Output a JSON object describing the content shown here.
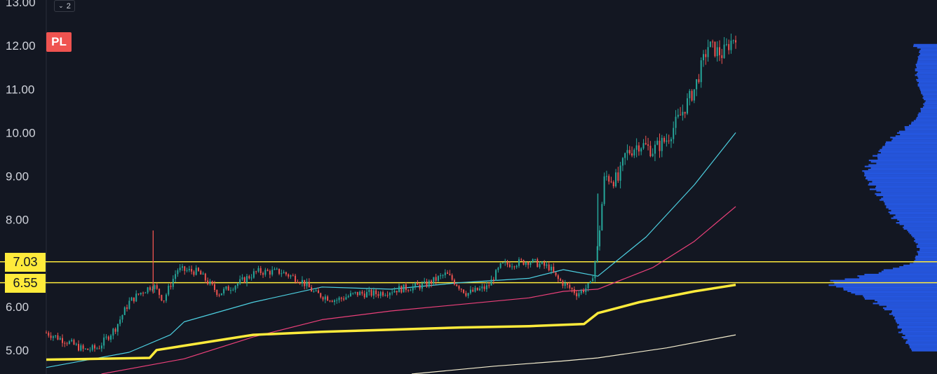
{
  "header": {
    "ticker": "PL",
    "indicator_toggle_count": "2"
  },
  "colors": {
    "background": "#131722",
    "bull": "#26a69a",
    "bear": "#ef5350",
    "ma_cyan": "#4dd0e1",
    "ma_pink": "#ec407a",
    "vwap_yellow": "#ffeb3b",
    "ma_long": "#f5eecf",
    "volume_profile": "#2962ff",
    "level_line": "#ffeb3b"
  },
  "chart_data": {
    "type": "candlestick",
    "y_axis": {
      "ticks": [
        "13.00",
        "12.00",
        "11.00",
        "10.00",
        "9.00",
        "8.00",
        "6.00",
        "5.00"
      ],
      "ylim": [
        4.45,
        13.05
      ]
    },
    "levels": [
      {
        "label": "7.03",
        "value": 7.03
      },
      {
        "label": "6.55",
        "value": 6.55
      }
    ],
    "price_anchors": [
      [
        0,
        5.4
      ],
      [
        0.03,
        5.2
      ],
      [
        0.055,
        5.0
      ],
      [
        0.075,
        5.05
      ],
      [
        0.1,
        5.5
      ],
      [
        0.12,
        6.1
      ],
      [
        0.135,
        6.3
      ],
      [
        0.155,
        6.5
      ],
      [
        0.17,
        6.15
      ],
      [
        0.19,
        6.85
      ],
      [
        0.22,
        6.8
      ],
      [
        0.25,
        6.3
      ],
      [
        0.28,
        6.55
      ],
      [
        0.305,
        6.8
      ],
      [
        0.34,
        6.8
      ],
      [
        0.37,
        6.6
      ],
      [
        0.39,
        6.3
      ],
      [
        0.42,
        6.15
      ],
      [
        0.45,
        6.3
      ],
      [
        0.48,
        6.3
      ],
      [
        0.51,
        6.4
      ],
      [
        0.55,
        6.5
      ],
      [
        0.58,
        6.75
      ],
      [
        0.61,
        6.3
      ],
      [
        0.64,
        6.45
      ],
      [
        0.66,
        6.95
      ],
      [
        0.7,
        7.05
      ],
      [
        0.73,
        6.9
      ],
      [
        0.74,
        6.65
      ],
      [
        0.77,
        6.3
      ],
      [
        0.79,
        6.5
      ],
      [
        0.8,
        7.4
      ],
      [
        0.81,
        9.0
      ],
      [
        0.83,
        8.9
      ],
      [
        0.84,
        9.5
      ],
      [
        0.86,
        9.75
      ],
      [
        0.88,
        9.6
      ],
      [
        0.9,
        9.85
      ],
      [
        0.92,
        10.4
      ],
      [
        0.94,
        11.0
      ],
      [
        0.96,
        12.0
      ],
      [
        0.98,
        11.8
      ],
      [
        1.0,
        12.25
      ]
    ],
    "series": [
      {
        "type": "line",
        "color": "#4dd0e1",
        "points": [
          [
            0,
            4.6
          ],
          [
            0.12,
            4.95
          ],
          [
            0.18,
            5.35
          ],
          [
            0.2,
            5.65
          ],
          [
            0.3,
            6.1
          ],
          [
            0.4,
            6.45
          ],
          [
            0.5,
            6.4
          ],
          [
            0.6,
            6.55
          ],
          [
            0.7,
            6.65
          ],
          [
            0.75,
            6.85
          ],
          [
            0.8,
            6.7
          ],
          [
            0.87,
            7.6
          ],
          [
            0.94,
            8.8
          ],
          [
            1.0,
            10.0
          ]
        ]
      },
      {
        "type": "line",
        "color": "#ec407a",
        "points": [
          [
            0.08,
            4.45
          ],
          [
            0.2,
            4.8
          ],
          [
            0.3,
            5.3
          ],
          [
            0.4,
            5.7
          ],
          [
            0.5,
            5.9
          ],
          [
            0.6,
            6.05
          ],
          [
            0.7,
            6.2
          ],
          [
            0.75,
            6.35
          ],
          [
            0.8,
            6.4
          ],
          [
            0.88,
            6.9
          ],
          [
            0.94,
            7.5
          ],
          [
            1.0,
            8.3
          ]
        ]
      },
      {
        "type": "line",
        "color": "#ffeb3b",
        "points": [
          [
            0,
            4.78
          ],
          [
            0.15,
            4.82
          ],
          [
            0.16,
            5.0
          ],
          [
            0.24,
            5.2
          ],
          [
            0.3,
            5.35
          ],
          [
            0.4,
            5.42
          ],
          [
            0.5,
            5.47
          ],
          [
            0.6,
            5.52
          ],
          [
            0.7,
            5.55
          ],
          [
            0.78,
            5.6
          ],
          [
            0.8,
            5.85
          ],
          [
            0.86,
            6.1
          ],
          [
            0.94,
            6.35
          ],
          [
            1.0,
            6.5
          ]
        ]
      },
      {
        "type": "line",
        "color": "#f5eecf",
        "points": [
          [
            0.53,
            4.45
          ],
          [
            0.65,
            4.63
          ],
          [
            0.75,
            4.75
          ],
          [
            0.8,
            4.82
          ],
          [
            0.9,
            5.05
          ],
          [
            1.0,
            5.35
          ]
        ]
      }
    ],
    "volume_profile": {
      "comment_free": true,
      "peaks": [
        [
          12.05,
          0.22
        ],
        [
          11.9,
          0.14
        ],
        [
          11.5,
          0.18
        ],
        [
          11.1,
          0.16
        ],
        [
          10.7,
          0.1
        ],
        [
          10.3,
          0.18
        ],
        [
          9.7,
          0.45
        ],
        [
          9.3,
          0.55
        ],
        [
          9.05,
          0.62
        ],
        [
          8.8,
          0.55
        ],
        [
          8.4,
          0.45
        ],
        [
          8.0,
          0.35
        ],
        [
          7.6,
          0.2
        ],
        [
          7.3,
          0.15
        ],
        [
          7.0,
          0.2
        ],
        [
          6.75,
          0.55
        ],
        [
          6.55,
          0.92
        ],
        [
          6.35,
          0.75
        ],
        [
          6.15,
          0.55
        ],
        [
          5.9,
          0.4
        ],
        [
          5.7,
          0.35
        ],
        [
          5.4,
          0.3
        ],
        [
          5.15,
          0.25
        ],
        [
          4.95,
          0.2
        ]
      ]
    }
  }
}
